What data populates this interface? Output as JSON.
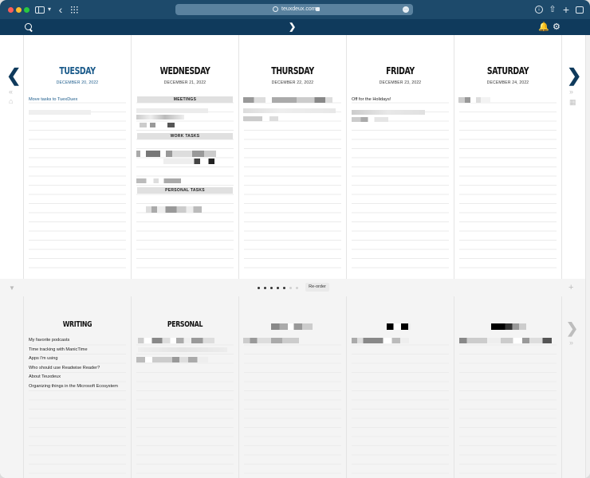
{
  "browser": {
    "url": "teuxdeux.com",
    "icons": [
      "sidebar-icon",
      "chevron-down-icon",
      "back-icon",
      "grid-icon",
      "shield-icon",
      "lock-icon",
      "more-icon",
      "download-icon",
      "share-icon",
      "plus-icon",
      "tabs-icon"
    ]
  },
  "appbar": {
    "icons": [
      "search-icon",
      "next-icon",
      "bell-icon",
      "gear-icon"
    ]
  },
  "days": [
    {
      "name": "TUESDAY",
      "date": "DECEMBER 20, 2022",
      "today": true
    },
    {
      "name": "WEDNESDAY",
      "date": "DECEMBER 21, 2022",
      "today": false
    },
    {
      "name": "THURSDAY",
      "date": "DECEMBER 22, 2022",
      "today": false
    },
    {
      "name": "FRIDAY",
      "date": "DECEMBER 23, 2022",
      "today": false
    },
    {
      "name": "SATURDAY",
      "date": "DECEMBER 24, 2022",
      "today": false
    }
  ],
  "tuesday_tasks": [
    "Move tasks to TuexDuex"
  ],
  "wednesday_sections": [
    "MEETINGS",
    "WORK TASKS",
    "PERSONAL TASKS"
  ],
  "friday_tasks": [
    "Off for the Holidays!"
  ],
  "midbar": {
    "reorder": "Re-order",
    "pages": 6,
    "active_pages": 5
  },
  "lists": [
    {
      "title": "WRITING",
      "items": [
        "My favorite podcasts",
        "Time tracking with ManicTime",
        "Apps I'm using",
        "Who should use Readwise Reader?",
        "About Teuxdeux",
        "Organizing things in the Microsoft Ecosystem"
      ]
    },
    {
      "title": "PERSONAL",
      "items": []
    }
  ],
  "colors": {
    "chrome": "#1d4a6b",
    "appbar": "#0f3a5c",
    "today": "#1a5a8a",
    "section": "#e0e0e0"
  }
}
